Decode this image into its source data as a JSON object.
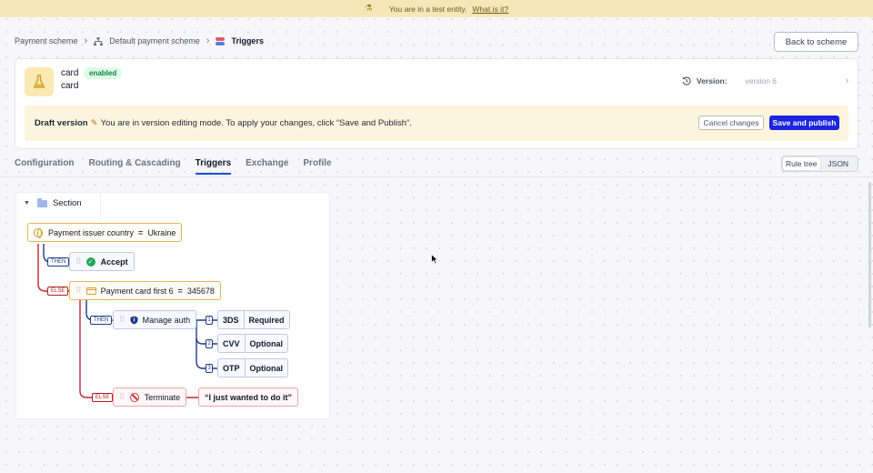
{
  "banner": {
    "message": "You are in a test entity.",
    "link": "What is it?"
  },
  "breadcrumb": {
    "items": [
      "Payment scheme",
      "Default payment scheme",
      "Triggers"
    ]
  },
  "back_button": "Back to scheme",
  "entity": {
    "title": "card",
    "status": "enabled",
    "subtitle": "card",
    "version_label": "Version:",
    "version_value": "version 6"
  },
  "draft": {
    "title": "Draft version",
    "message": "You are in version editing mode. To apply your changes, click “Save and Publish”.",
    "cancel": "Cancel changes",
    "publish": "Save and publish"
  },
  "tabs": [
    "Configuration",
    "Routing & Cascading",
    "Triggers",
    "Exchange",
    "Profile"
  ],
  "active_tab": "Triggers",
  "view_toggle": {
    "options": [
      "Rule tree",
      "JSON"
    ],
    "selected": "Rule tree"
  },
  "tree": {
    "section_label": "Section",
    "root_condition": {
      "field": "Payment issuer country",
      "value": "Ukraine"
    },
    "then_label": "THEN",
    "else_label": "ELSE",
    "accept": "Accept",
    "second_condition": {
      "field": "Payment card first 6",
      "value": "345678"
    },
    "manage_auth": "Manage auth",
    "auth_rules": [
      {
        "index": "1",
        "key": "3DS",
        "value": "Required"
      },
      {
        "index": "2",
        "key": "CVV",
        "value": "Optional"
      },
      {
        "index": "3",
        "key": "OTP",
        "value": "Optional"
      }
    ],
    "terminate": "Terminate",
    "terminate_message": "“I just wanted to do it”"
  },
  "colors": {
    "accent": "#1d25e0",
    "banner": "#f6e7b8",
    "draft": "#fdf4de",
    "then_line": "#1e3a8a",
    "else_line": "#c0263a",
    "condition_border": "#e5b25a"
  }
}
